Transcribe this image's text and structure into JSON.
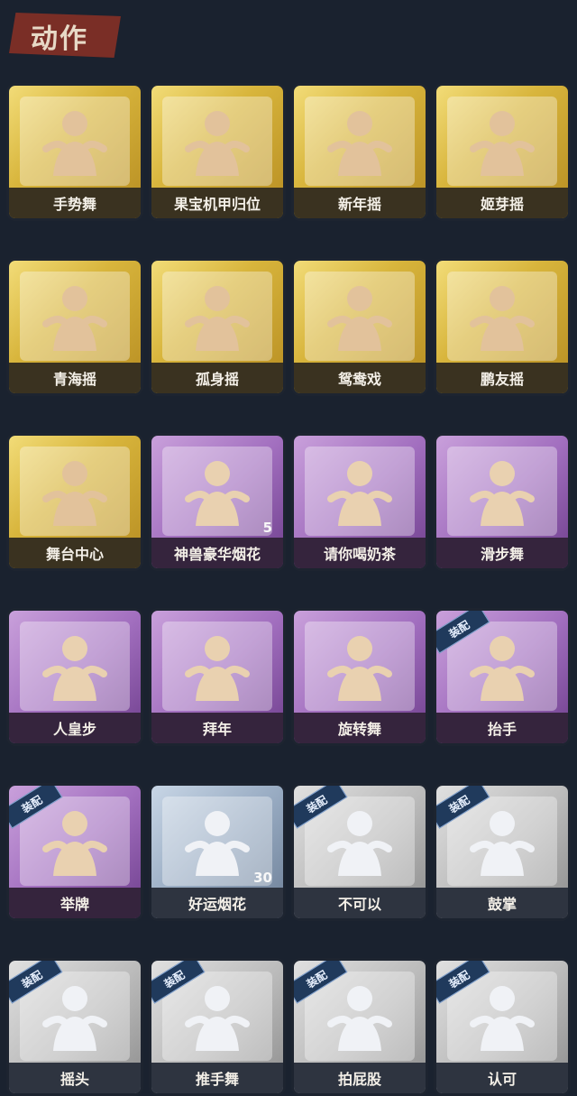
{
  "header": {
    "title": "动作"
  },
  "cards": [
    {
      "label": "手势舞",
      "style": "gold",
      "equipped": false,
      "count": ""
    },
    {
      "label": "果宝机甲归位",
      "style": "gold",
      "equipped": false,
      "count": ""
    },
    {
      "label": "新年摇",
      "style": "gold",
      "equipped": false,
      "count": ""
    },
    {
      "label": "姬芽摇",
      "style": "gold",
      "equipped": false,
      "count": ""
    },
    {
      "label": "青海摇",
      "style": "gold",
      "equipped": false,
      "count": ""
    },
    {
      "label": "孤身摇",
      "style": "gold",
      "equipped": false,
      "count": ""
    },
    {
      "label": "鸳鸯戏",
      "style": "gold",
      "equipped": false,
      "count": ""
    },
    {
      "label": "鹏友摇",
      "style": "gold",
      "equipped": false,
      "count": ""
    },
    {
      "label": "舞台中心",
      "style": "gold",
      "equipped": false,
      "count": ""
    },
    {
      "label": "神兽豪华烟花",
      "style": "purple",
      "equipped": false,
      "count": "5"
    },
    {
      "label": "请你喝奶茶",
      "style": "purple",
      "equipped": false,
      "count": ""
    },
    {
      "label": "滑步舞",
      "style": "purple",
      "equipped": false,
      "count": ""
    },
    {
      "label": "人皇步",
      "style": "purple",
      "equipped": false,
      "count": ""
    },
    {
      "label": "拜年",
      "style": "purple",
      "equipped": false,
      "count": ""
    },
    {
      "label": "旋转舞",
      "style": "purple",
      "equipped": false,
      "count": ""
    },
    {
      "label": "抬手",
      "style": "purple",
      "equipped": true,
      "count": ""
    },
    {
      "label": "举牌",
      "style": "purple",
      "equipped": true,
      "count": ""
    },
    {
      "label": "好运烟花",
      "style": "blue",
      "equipped": false,
      "count": "30"
    },
    {
      "label": "不可以",
      "style": "grey",
      "equipped": true,
      "count": ""
    },
    {
      "label": "鼓掌",
      "style": "grey",
      "equipped": true,
      "count": ""
    },
    {
      "label": "摇头",
      "style": "grey",
      "equipped": true,
      "count": ""
    },
    {
      "label": "推手舞",
      "style": "grey",
      "equipped": true,
      "count": ""
    },
    {
      "label": "拍屁股",
      "style": "grey",
      "equipped": true,
      "count": ""
    },
    {
      "label": "认可",
      "style": "grey",
      "equipped": true,
      "count": ""
    }
  ],
  "badge_label": "装配"
}
